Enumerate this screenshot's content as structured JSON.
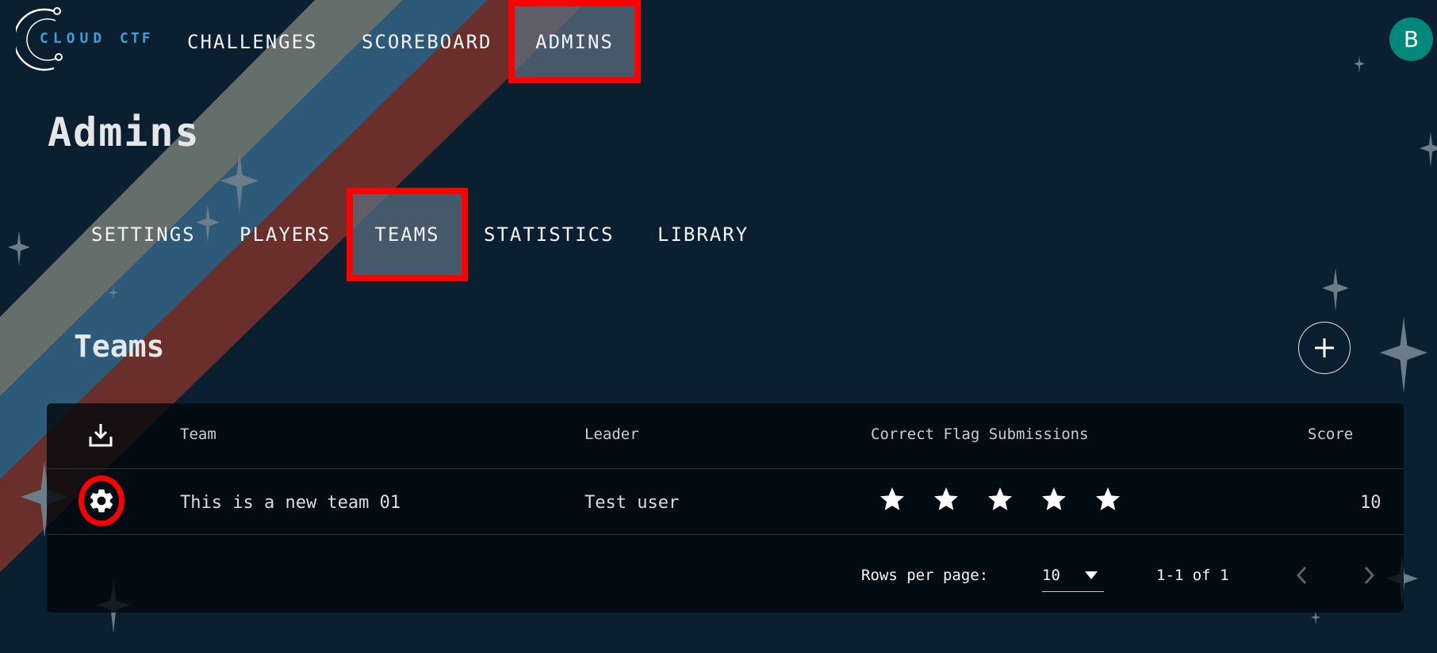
{
  "brand": {
    "logo_text_1": "CLOUD",
    "logo_text_2": "CTF",
    "logo_accent": "#3e9fd6"
  },
  "topnav": {
    "items": [
      {
        "label": "CHALLENGES",
        "active": false
      },
      {
        "label": "SCOREBOARD",
        "active": false
      },
      {
        "label": "ADMINS",
        "active": true
      }
    ]
  },
  "user": {
    "avatar_initial": "B",
    "avatar_color": "#00897b"
  },
  "page": {
    "title": "Admins"
  },
  "subnav": {
    "items": [
      {
        "label": "SETTINGS",
        "active": false
      },
      {
        "label": "PLAYERS",
        "active": false
      },
      {
        "label": "TEAMS",
        "active": true
      },
      {
        "label": "STATISTICS",
        "active": false
      },
      {
        "label": "LIBRARY",
        "active": false
      }
    ]
  },
  "section": {
    "title": "Teams",
    "add_icon": "plus-icon"
  },
  "table": {
    "columns": [
      "Team",
      "Leader",
      "Correct Flag Submissions",
      "Score"
    ],
    "export_icon": "download-icon",
    "rows": [
      {
        "team": "This is a new team 01",
        "leader": "Test user",
        "flag_submissions_stars": 5,
        "score": "10",
        "action_icon": "gear-icon"
      }
    ]
  },
  "pagination": {
    "rows_per_page_label": "Rows per page:",
    "rows_per_page_value": "10",
    "range_text": "1-1 of 1",
    "prev_icon": "chevron-left-icon",
    "next_icon": "chevron-right-icon"
  },
  "colors": {
    "background": "#0a1f30",
    "stripe_gray": "#646e6a",
    "stripe_blue": "#2d5a78",
    "stripe_red": "#6b2f2b",
    "highlight": "#ff0000",
    "sparkle": "#6b7d89"
  }
}
